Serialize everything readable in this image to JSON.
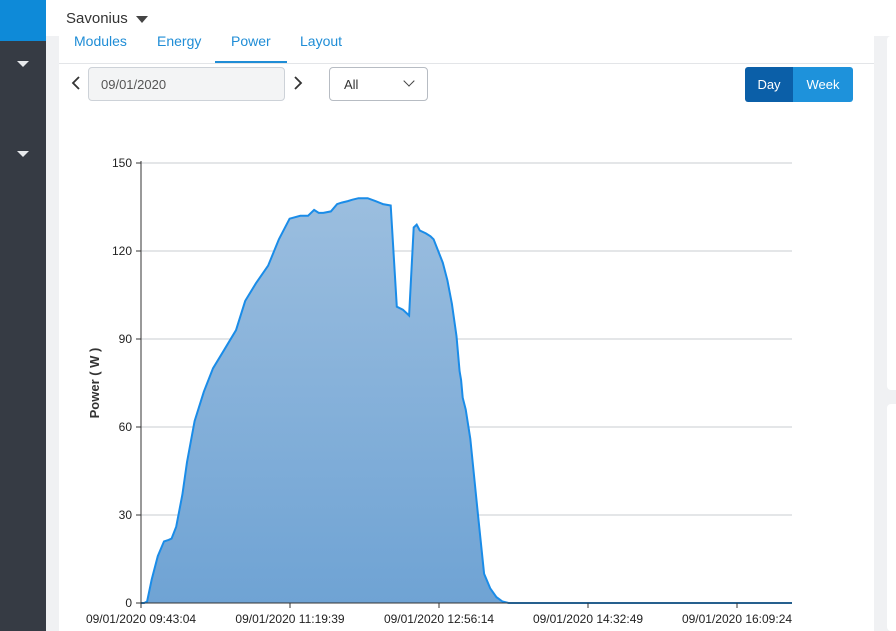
{
  "header": {
    "site_name": "Savonius"
  },
  "tabs": [
    {
      "label": "Modules"
    },
    {
      "label": "Energy"
    },
    {
      "label": "Power"
    },
    {
      "label": "Layout"
    }
  ],
  "toolbar": {
    "date_value": "09/01/2020",
    "filter_value": "All",
    "day_label": "Day",
    "week_label": "Week",
    "prev_icon": "chevron-left-icon",
    "next_icon": "chevron-right-icon"
  },
  "colors": {
    "accent": "#1f8dd6",
    "area_fill_top": "#9bbedf",
    "area_fill_bottom": "#6fa3d4",
    "line": "#1a8ce8"
  },
  "chart_data": {
    "type": "area",
    "ylabel": "Power ( W )",
    "xlabel": "",
    "ylim": [
      0,
      150
    ],
    "yticks": [
      0,
      30,
      60,
      90,
      120,
      150
    ],
    "xtick_labels": [
      "09/01/2020 09:43:04",
      "09/01/2020 11:19:39",
      "09/01/2020 12:56:14",
      "09/01/2020 14:32:49",
      "09/01/2020 16:09:24"
    ],
    "grid": true,
    "x_minutes": [
      0,
      2,
      4,
      7,
      11,
      15,
      18,
      20,
      23,
      27,
      30,
      35,
      41,
      47,
      54,
      62,
      68,
      75,
      83,
      90,
      97,
      104,
      109,
      113,
      116,
      119,
      124,
      128,
      131,
      135,
      138,
      142,
      148,
      153,
      158,
      163,
      167,
      171,
      175,
      178,
      180,
      182,
      186,
      189,
      191,
      194,
      197,
      200,
      203,
      206,
      208,
      209,
      210,
      212,
      215,
      220,
      224,
      228,
      232,
      236,
      240,
      245,
      249,
      253,
      257,
      260,
      262,
      264,
      266,
      268,
      272,
      276,
      280,
      284,
      288,
      292,
      296,
      300,
      306,
      312,
      320,
      330,
      340,
      350,
      360,
      370,
      380,
      390,
      400,
      410,
      420,
      425
    ],
    "y_values": [
      0,
      0,
      0.5,
      8,
      16,
      21,
      21.5,
      22,
      26,
      37,
      48,
      62,
      72,
      80,
      86,
      93,
      103,
      109,
      115,
      124,
      131,
      132,
      132,
      134,
      133,
      133,
      133.5,
      136,
      136.5,
      137,
      137.5,
      138,
      138,
      137,
      136,
      135.5,
      101,
      100,
      98,
      128,
      129,
      127,
      126,
      125,
      124,
      120,
      116,
      110,
      102,
      91,
      79,
      76,
      70,
      66,
      56,
      30,
      10,
      5,
      2,
      0.5,
      0,
      0,
      0,
      0,
      0,
      0,
      0,
      0,
      0,
      0,
      0,
      0,
      0,
      0,
      0,
      0,
      0,
      0,
      0,
      0,
      0,
      0,
      0,
      0,
      0,
      0,
      0,
      0,
      0,
      0,
      0,
      0
    ]
  }
}
